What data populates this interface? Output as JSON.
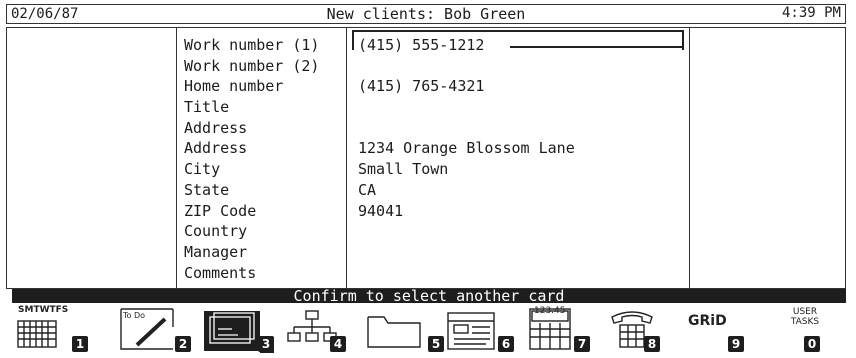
{
  "header": {
    "date": "02/06/87",
    "title": "New clients: Bob Green",
    "time": "4:39 PM"
  },
  "card": {
    "labels": [
      "Work number (1)",
      "Work number (2)",
      "Home number",
      "Title",
      "Address",
      "Address",
      "City",
      "State",
      "ZIP Code",
      "Country",
      "Manager",
      "Comments"
    ],
    "values": [
      "(415) 555-1212",
      "",
      "(415) 765-4321",
      "",
      "",
      "1234 Orange Blossom Lane",
      "Small Town",
      "CA",
      "94041",
      "",
      "",
      ""
    ]
  },
  "status": {
    "message": "Confirm to select another card"
  },
  "fkeys": [
    {
      "num": "1",
      "icon": "calendar-icon",
      "caption": "SMTWTFS"
    },
    {
      "num": "2",
      "icon": "todo-icon",
      "caption": "To Do"
    },
    {
      "num": "3",
      "icon": "cards-icon",
      "caption": ""
    },
    {
      "num": "4",
      "icon": "org-chart-icon",
      "caption": ""
    },
    {
      "num": "5",
      "icon": "folder-icon",
      "caption": ""
    },
    {
      "num": "6",
      "icon": "document-icon",
      "caption": ""
    },
    {
      "num": "7",
      "icon": "calculator-icon",
      "caption": "123.45"
    },
    {
      "num": "8",
      "icon": "phone-icon",
      "caption": ""
    },
    {
      "num": "9",
      "icon": "grid-icon",
      "caption": "GRiD"
    },
    {
      "num": "0",
      "icon": "user-tasks-icon",
      "caption": "USER TASKS"
    }
  ]
}
